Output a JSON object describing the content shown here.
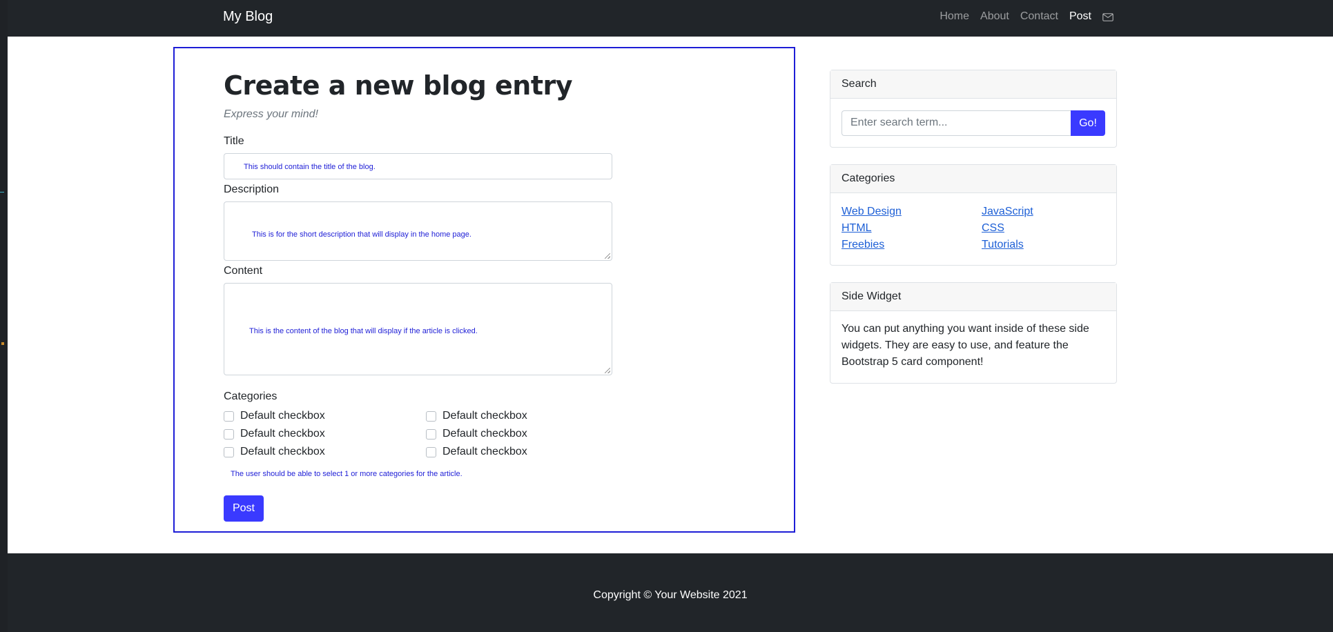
{
  "navbar": {
    "brand": "My Blog",
    "links": [
      {
        "label": "Home"
      },
      {
        "label": "About"
      },
      {
        "label": "Contact"
      },
      {
        "label": "Post",
        "active": true
      }
    ],
    "mail_icon": "envelope-icon"
  },
  "form": {
    "title": "Create a new blog entry",
    "subtitle": "Express your mind!",
    "title_label": "Title",
    "title_hint": "This should contain the title of the blog.",
    "description_label": "Description",
    "description_hint": "This is for the short description that will display in the home page.",
    "content_label": "Content",
    "content_hint": "This is the content of the blog that will display if the article is clicked.",
    "categories_label": "Categories",
    "checkboxes": [
      {
        "label": "Default checkbox",
        "checked": false
      },
      {
        "label": "Default checkbox",
        "checked": false
      },
      {
        "label": "Default checkbox",
        "checked": false
      },
      {
        "label": "Default checkbox",
        "checked": false
      },
      {
        "label": "Default checkbox",
        "checked": false
      },
      {
        "label": "Default checkbox",
        "checked": false
      }
    ],
    "categories_hint": "The user should be able to select 1 or more categories for the article.",
    "post_label": "Post"
  },
  "sidebar": {
    "search": {
      "header": "Search",
      "placeholder": "Enter search term...",
      "button": "Go!"
    },
    "categories": {
      "header": "Categories",
      "links": [
        "Web Design",
        "JavaScript",
        "HTML",
        "CSS",
        "Freebies",
        "Tutorials"
      ]
    },
    "widget": {
      "header": "Side Widget",
      "text": "You can put anything you want inside of these side widgets. They are easy to use, and feature the Bootstrap 5 card component!"
    }
  },
  "footer": {
    "copyright": "Copyright © Your Website 2021"
  },
  "colors": {
    "navbar_bg": "#212529",
    "accent": "#3a3aff",
    "annotation": "#1d1dd6",
    "link": "#1d5fd6"
  }
}
